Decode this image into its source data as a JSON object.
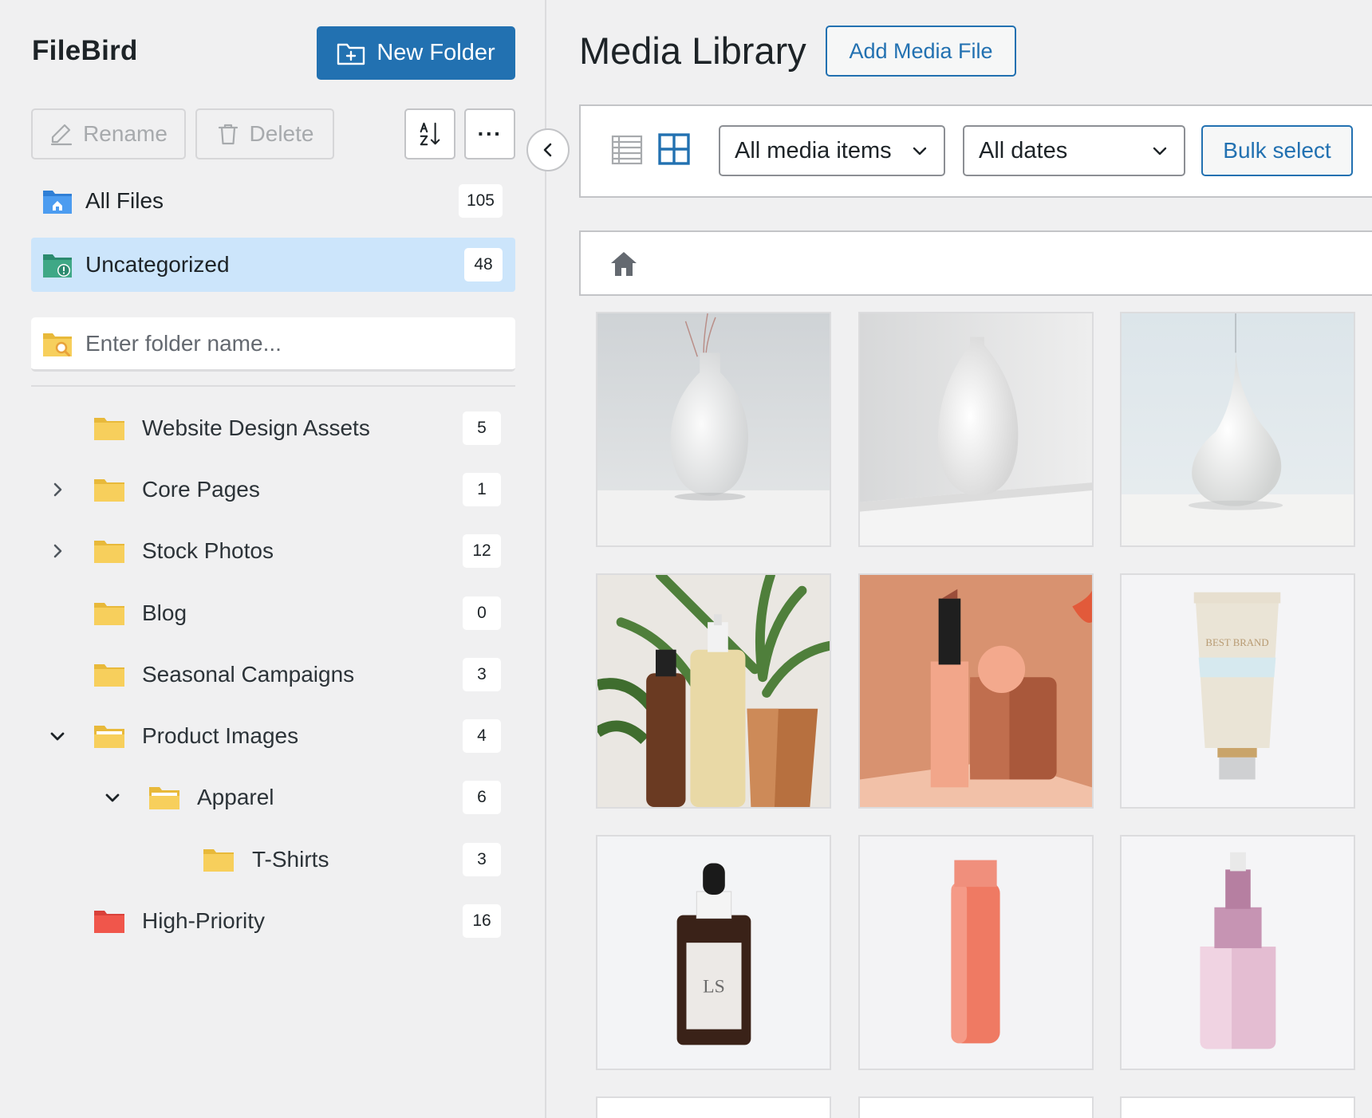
{
  "sidebar": {
    "brand": "FileBird",
    "new_folder_label": "New Folder",
    "rename_label": "Rename",
    "delete_label": "Delete",
    "more_label": "···",
    "all_files": {
      "label": "All Files",
      "count": "105"
    },
    "uncategorized": {
      "label": "Uncategorized",
      "count": "48"
    },
    "search_placeholder": "Enter folder name...",
    "folders": [
      {
        "label": "Website Design Assets",
        "count": "5",
        "toggle": "none",
        "depth": 0,
        "color": "#f7c948"
      },
      {
        "label": "Core Pages",
        "count": "1",
        "toggle": "collapsed",
        "depth": 0,
        "color": "#f7c948"
      },
      {
        "label": "Stock Photos",
        "count": "12",
        "toggle": "collapsed",
        "depth": 0,
        "color": "#f7c948"
      },
      {
        "label": "Blog",
        "count": "0",
        "toggle": "none",
        "depth": 0,
        "color": "#f7c948"
      },
      {
        "label": "Seasonal Campaigns",
        "count": "3",
        "toggle": "none",
        "depth": 0,
        "color": "#f7c948"
      },
      {
        "label": "Product Images",
        "count": "4",
        "toggle": "expanded",
        "depth": 0,
        "color": "#f7c948"
      },
      {
        "label": "Apparel",
        "count": "6",
        "toggle": "expanded",
        "depth": 1,
        "color": "#f7c948"
      },
      {
        "label": "T-Shirts",
        "count": "3",
        "toggle": "none",
        "depth": 2,
        "color": "#f7c948"
      },
      {
        "label": "High-Priority",
        "count": "16",
        "toggle": "none",
        "depth": 0,
        "color": "#f0564b"
      }
    ]
  },
  "main": {
    "title": "Media Library",
    "add_media_label": "Add Media File",
    "filter_media": "All media items",
    "filter_dates": "All dates",
    "bulk_select_label": "Bulk select",
    "media_tiles": [
      {
        "subject": "vase-with-reeds"
      },
      {
        "subject": "white-vase-on-ledge"
      },
      {
        "subject": "teardrop-vase"
      },
      {
        "subject": "bottles-with-plant"
      },
      {
        "subject": "lipstick-peach"
      },
      {
        "subject": "cream-tube",
        "text": "BEST BRAND"
      },
      {
        "subject": "dropper-bottle",
        "text": "LS"
      },
      {
        "subject": "coral-bottle"
      },
      {
        "subject": "pink-perfume"
      }
    ]
  },
  "colors": {
    "accent": "#2271b1",
    "active_row": "#cce5fb",
    "folder_yellow": "#f7c948",
    "folder_red": "#f0564b"
  }
}
